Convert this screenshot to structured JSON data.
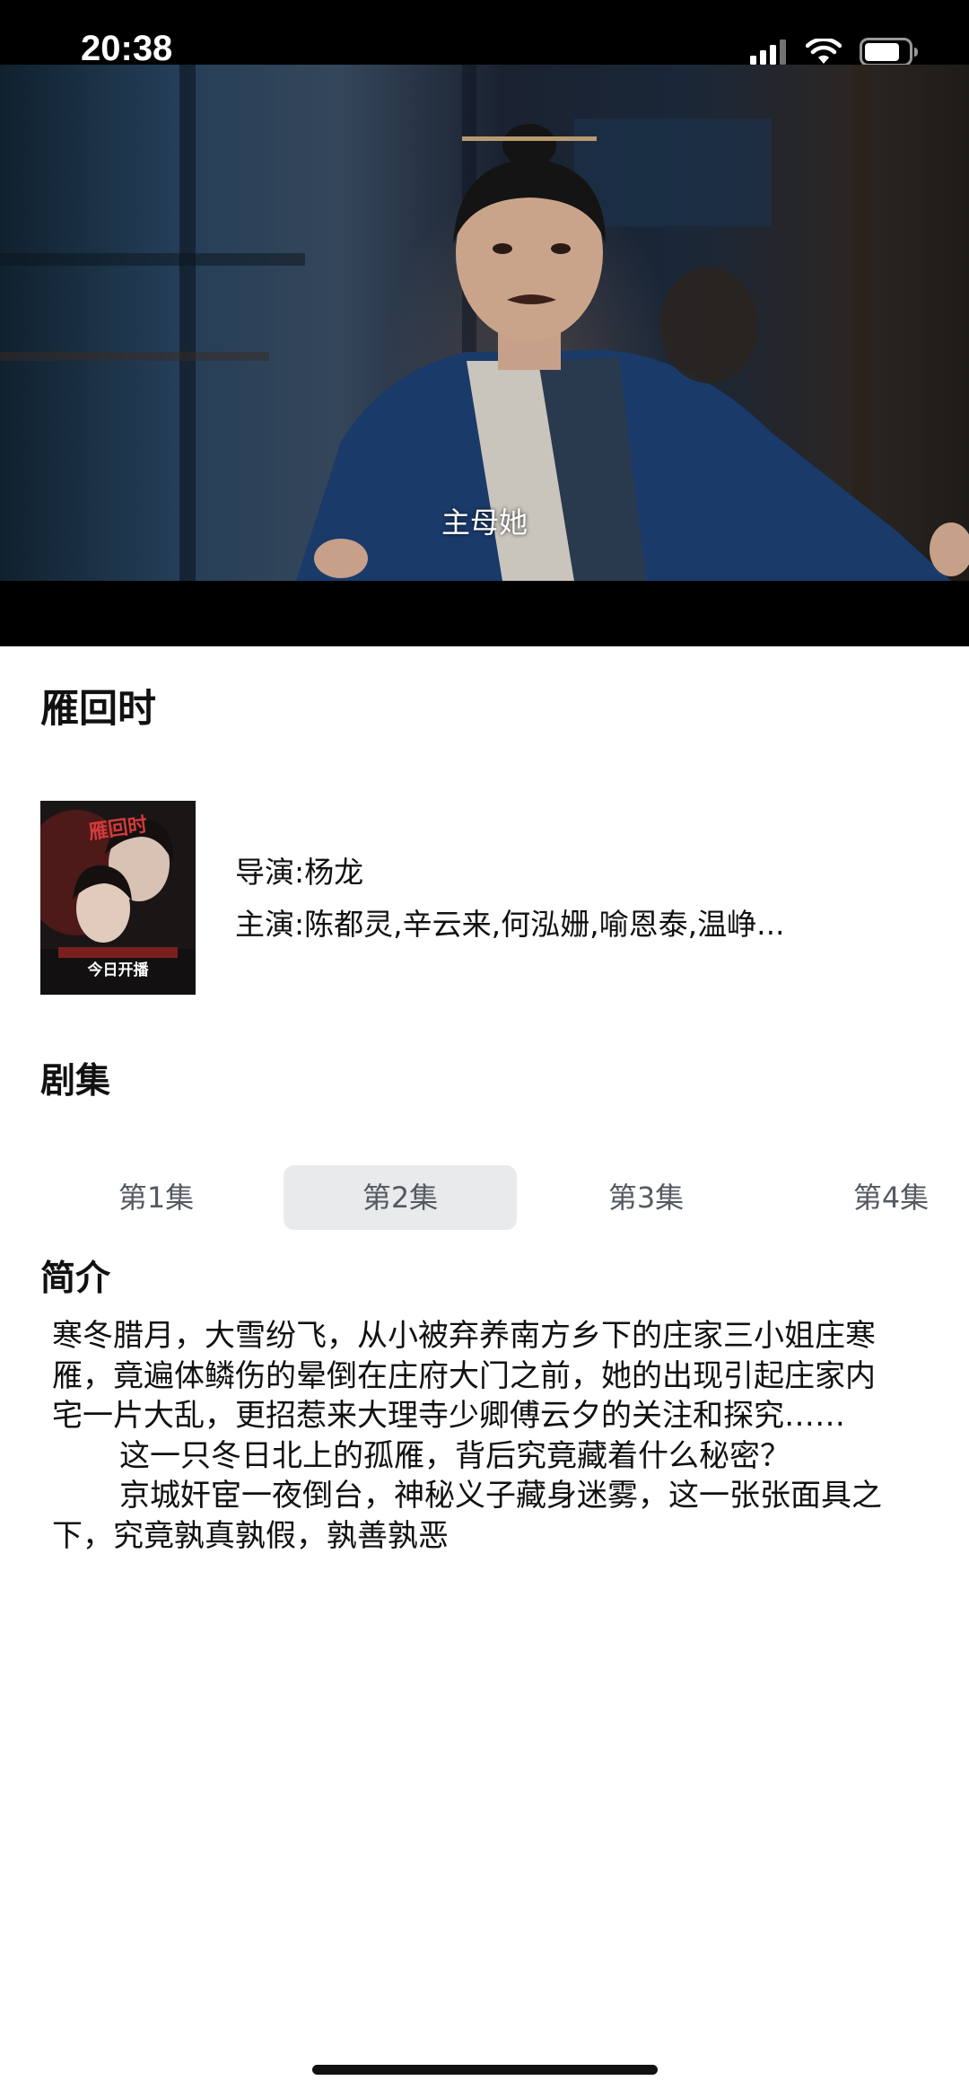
{
  "status_bar": {
    "time": "20:38"
  },
  "player": {
    "subtitle": "主母她"
  },
  "show": {
    "title": "雁回时",
    "director": "导演:杨龙",
    "cast": "主演:陈都灵,辛云来,何泓姗,喻恩泰,温峥...",
    "poster_logo": "雁回时",
    "poster_banner": "今日开播"
  },
  "episodes": {
    "heading": "剧集",
    "selected_index": 1,
    "items": [
      {
        "label": "第1集"
      },
      {
        "label": "第2集"
      },
      {
        "label": "第3集"
      },
      {
        "label": "第4集"
      }
    ]
  },
  "intro": {
    "heading": "简介",
    "paragraphs": [
      "寒冬腊月，大雪纷飞，从小被弃养南方乡下的庄家三小姐庄寒雁，竟遍体鳞伤的晕倒在庄府大门之前，她的出现引起庄家内宅一片大乱，更招惹来大理寺少卿傅云夕的关注和探究……",
      "这一只冬日北上的孤雁，背后究竟藏着什么秘密？",
      "京城奸宦一夜倒台，神秘义子藏身迷雾，这一张张面具之下，究竟孰真孰假，孰善孰恶"
    ]
  },
  "colors": {
    "selected_tab_bg": "#e8eaec",
    "tab_text": "#555a60",
    "text": "#111111"
  },
  "icons": [
    "signal-icon",
    "wifi-icon",
    "battery-icon"
  ]
}
